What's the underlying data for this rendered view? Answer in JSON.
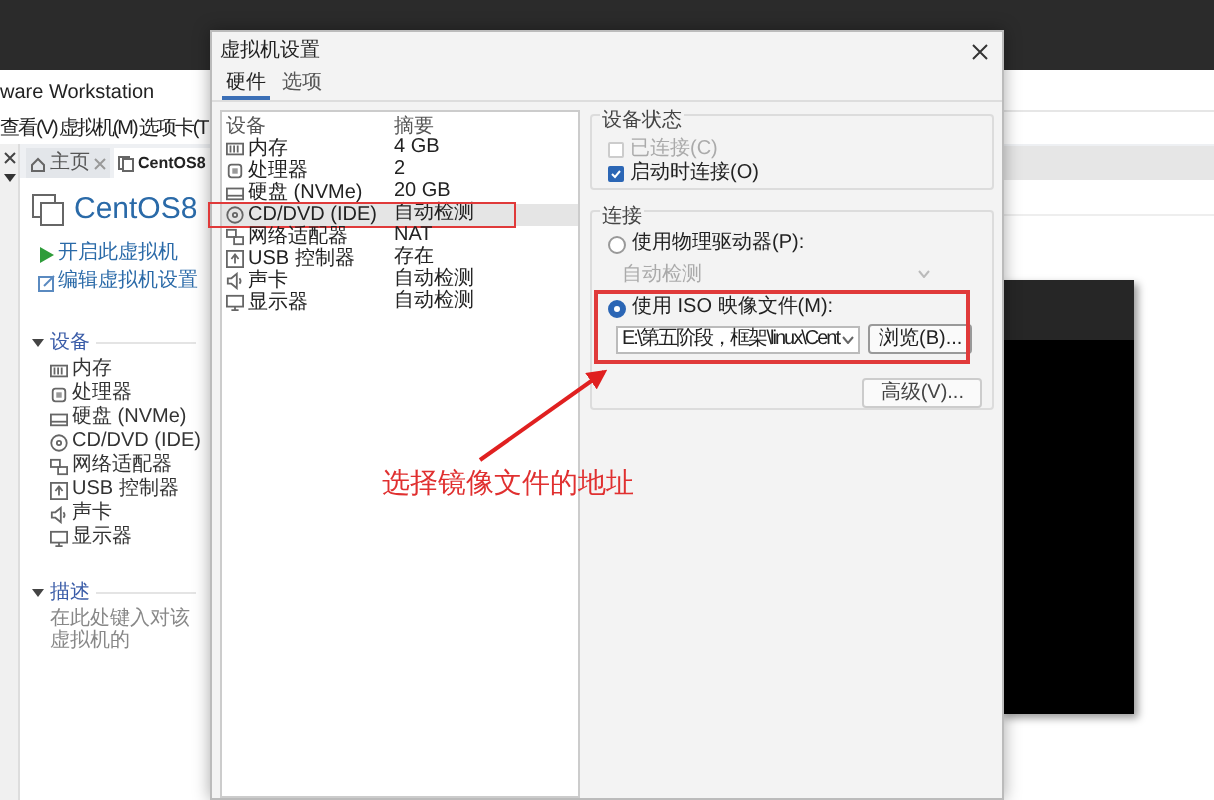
{
  "background_app": {
    "title": "ware Workstation",
    "menu": [
      "查看(V)",
      "虚拟机(M)",
      "选项卡(T"
    ],
    "tabs": [
      {
        "label": "主页",
        "selected": false
      },
      {
        "label": "CentOS8",
        "selected": true
      }
    ],
    "vm_name": "CentOS8",
    "actions": [
      {
        "kind": "play",
        "label": "开启此虚拟机"
      },
      {
        "kind": "edit",
        "label": "编辑虚拟机设置"
      }
    ],
    "devices_section": {
      "title": "设备",
      "expanded": true,
      "items": [
        {
          "kind": "memory",
          "label": "内存"
        },
        {
          "kind": "cpu",
          "label": "处理器"
        },
        {
          "kind": "disk",
          "label": "硬盘 (NVMe)"
        },
        {
          "kind": "cdrom",
          "label": "CD/DVD (IDE)"
        },
        {
          "kind": "network",
          "label": "网络适配器"
        },
        {
          "kind": "usb",
          "label": "USB 控制器"
        },
        {
          "kind": "sound",
          "label": "声卡"
        },
        {
          "kind": "display",
          "label": "显示器"
        }
      ]
    },
    "description_section": {
      "title": "描述",
      "expanded": true,
      "placeholder": "在此处键入对该虚拟机的"
    }
  },
  "dialog": {
    "title": "虚拟机设置",
    "tabs": [
      {
        "label": "硬件",
        "selected": true
      },
      {
        "label": "选项",
        "selected": false
      }
    ],
    "device_table": {
      "columns": [
        "设备",
        "摘要"
      ],
      "rows": [
        {
          "kind": "memory",
          "device": "内存",
          "summary": "4 GB",
          "selected": false
        },
        {
          "kind": "cpu",
          "device": "处理器",
          "summary": "2",
          "selected": false
        },
        {
          "kind": "disk",
          "device": "硬盘 (NVMe)",
          "summary": "20 GB",
          "selected": false
        },
        {
          "kind": "cdrom",
          "device": "CD/DVD (IDE)",
          "summary": "自动检测",
          "selected": true
        },
        {
          "kind": "network",
          "device": "网络适配器",
          "summary": "NAT",
          "selected": false
        },
        {
          "kind": "usb",
          "device": "USB 控制器",
          "summary": "存在",
          "selected": false
        },
        {
          "kind": "sound",
          "device": "声卡",
          "summary": "自动检测",
          "selected": false
        },
        {
          "kind": "display",
          "device": "显示器",
          "summary": "自动检测",
          "selected": false
        }
      ]
    },
    "device_status": {
      "title": "设备状态",
      "options": [
        {
          "label": "已连接(C)",
          "checked": false,
          "disabled": true
        },
        {
          "label": "启动时连接(O)",
          "checked": true,
          "disabled": false
        }
      ]
    },
    "connection": {
      "title": "连接",
      "options": [
        {
          "kind": "drive",
          "label": "使用物理驱动器(P):",
          "selected": false,
          "value": "自动检测"
        },
        {
          "kind": "iso",
          "label": "使用 ISO 映像文件(M):",
          "selected": true,
          "value": "E:\\第五阶段，框架\\linux\\Cent",
          "button": "浏览(B)..."
        }
      ]
    },
    "advanced_button": "高级(V)..."
  },
  "annotation": {
    "text": "选择镜像文件的地址"
  }
}
